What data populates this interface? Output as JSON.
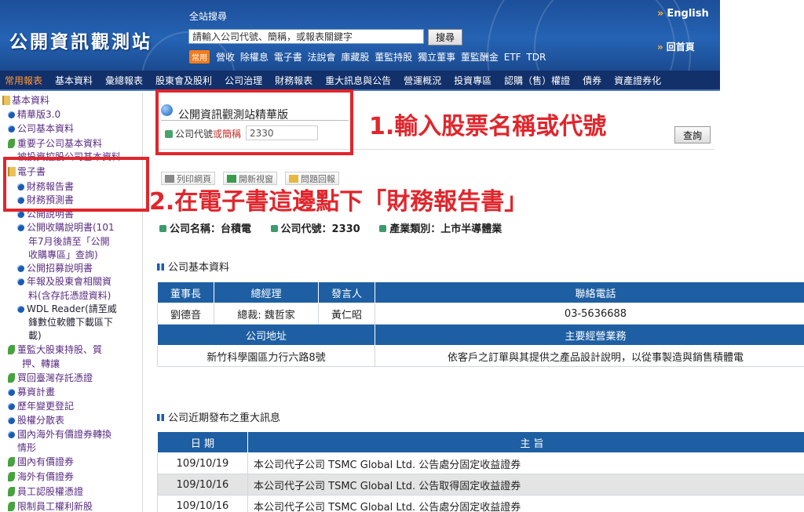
{
  "header": {
    "logo": "公開資訊觀測站",
    "search_label": "全站搜尋",
    "search_placeholder": "請輸入公司代號、簡稱，或報表關鍵字",
    "search_button": "搜尋",
    "common_tag": "常用",
    "quick_links": [
      "營收",
      "除權息",
      "電子書",
      "法說會",
      "庫藏股",
      "董監持股",
      "獨立董事",
      "董監酬金",
      "ETF",
      "TDR"
    ],
    "english": "English",
    "home": "回首頁"
  },
  "nav": [
    "常用報表",
    "基本資料",
    "彙總報表",
    "股東會及股利",
    "公司治理",
    "財務報表",
    "重大訊息與公告",
    "營運概況",
    "投資專區",
    "認購（售）權證",
    "債券",
    "資產證券化"
  ],
  "sidebar": {
    "root": "基本資料",
    "items": [
      "精華版3.0",
      "公司基本資料",
      "重要子公司基本資料",
      "被投資控股公司基本資料",
      "電子書",
      "財務報告書",
      "財務預測書",
      "公開說明書",
      "公開收購說明書(101",
      "年7月後請至「公開",
      "收購專區」查詢)",
      "公開招募說明書",
      "年報及股東會相關資",
      "料(含存託憑證資料)",
      "WDL Reader(請至威",
      "鋒數位軟體下載區下",
      "載)",
      "董監大股東持股、質",
      "押、轉讓",
      "買回臺灣存託憑證",
      "募資計畫",
      "歷年變更登記",
      "股權分散表",
      "國內海外有價證券轉換",
      "情形",
      "國內有價證券",
      "海外有價證券",
      "員工認股權憑證",
      "限制員工權利新股"
    ]
  },
  "main": {
    "title": "公開資訊觀測站精華版",
    "code_label": "公司代號",
    "code_label_or": "或簡稱",
    "code_value": "2330",
    "query_button": "查詢",
    "tools": [
      "列印網頁",
      "開新視窗",
      "問題回報"
    ],
    "annotation1": "1.輸入股票名稱或代號",
    "annotation2": "2.在電子書這邊點下「財務報告書」",
    "company_name": "公司名稱：台積電",
    "company_code": "公司代號：2330",
    "industry": "產業類別：上市半導體業",
    "basic_section": "公司基本資料",
    "basic_table": {
      "headers": [
        "董事長",
        "總經理",
        "發言人",
        "聯絡電話"
      ],
      "row": [
        "劉德音",
        "總裁: 魏哲家",
        "黃仁昭",
        "03-5636688"
      ],
      "headers2": [
        "公司地址",
        "主要經營業務"
      ],
      "row2": [
        "新竹科學園區力行六路8號",
        "依客戶之訂單與其提供之產品設計說明，以從事製造與銷售積體電"
      ]
    },
    "news_section": "公司近期發布之重大訊息",
    "news_table": {
      "headers": [
        "日 期",
        "主 旨"
      ],
      "rows": [
        {
          "date": "109/10/19",
          "subject": "本公司代子公司 TSMC Global Ltd. 公告處分固定收益證券"
        },
        {
          "date": "109/10/16",
          "subject": "本公司代子公司 TSMC Global Ltd. 公告取得固定收益證券"
        },
        {
          "date": "109/10/16",
          "subject": "本公司代子公司 TSMC Global Ltd. 公告處分固定收益證券"
        }
      ]
    }
  }
}
